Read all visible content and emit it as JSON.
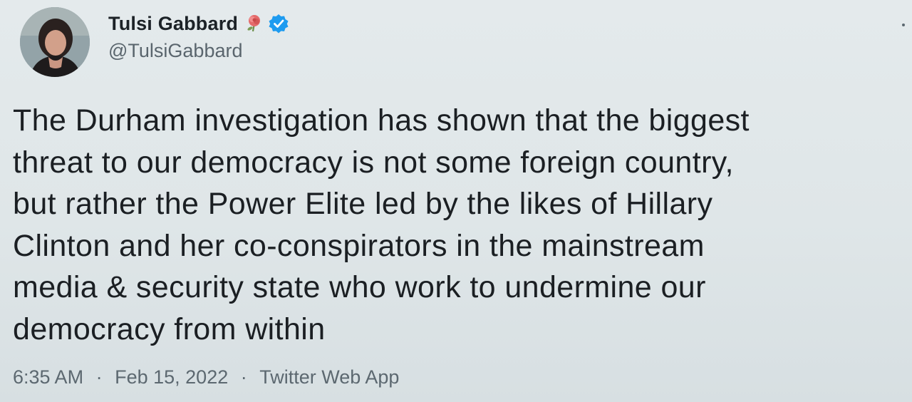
{
  "author": {
    "display_name": "Tulsi Gabbard",
    "handle": "@TulsiGabbard",
    "avatar_icon": "avatar-photo",
    "badge_emoji_icon": "rose-icon",
    "verified_icon": "verified-badge-icon"
  },
  "tweet": {
    "lines": [
      "The Durham investigation has shown that the biggest",
      "threat to our democracy is not some foreign country,",
      "but rather the Power Elite led by the likes of Hillary",
      "Clinton and her co-conspirators in the mainstream",
      "media & security state who work to undermine our",
      "democracy from within"
    ]
  },
  "meta": {
    "time": "6:35 AM",
    "separator": "·",
    "date": "Feb 15, 2022",
    "source": "Twitter Web App"
  },
  "colors": {
    "background": "#dfe6e8",
    "text": "#1b1f23",
    "secondary_text": "#5c6870",
    "verified_blue": "#1d9bf0"
  }
}
